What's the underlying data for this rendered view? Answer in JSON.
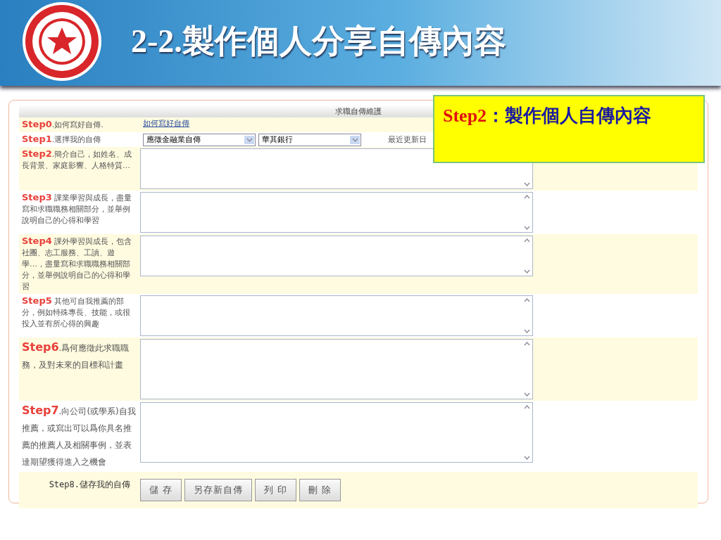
{
  "slide": {
    "title": "2-2.製作個人分享自傳內容"
  },
  "form": {
    "heading": "求職自傳維護",
    "steps": [
      {
        "kind": "link",
        "step": "Step0",
        "text": ".如何寫好自傳.",
        "link": "如何寫好自傳"
      },
      {
        "kind": "select",
        "step": "Step1",
        "text": ".選擇我的自傳",
        "selects": [
          "應徵金融業自傳",
          "華其銀行"
        ],
        "note": "最近更新日"
      },
      {
        "kind": "textarea",
        "step": "Step2",
        "text": ".簡介自己，如姓名、成長背景、家庭影響、人格特質…"
      },
      {
        "kind": "textarea",
        "step": "Step3",
        "text": " 課業學習與成長，盡量寫和求職職務相關部分，並舉例說明自己的心得和學習"
      },
      {
        "kind": "textarea",
        "step": "Step4",
        "text": " 課外學習與成長，包含社團、志工服務、工讀、遊學…，盡量寫和求職職務相關部分，並舉例說明自己的心得和學習"
      },
      {
        "kind": "textarea",
        "step": "Step5",
        "text": " 其他可自我推薦的部分，例如特殊專長、技能，或很投入並有所心得的興趣"
      },
      {
        "kind": "large",
        "step": "Step6",
        "text": ".爲何應徵此求職職務，及對未來的目標和計畫"
      },
      {
        "kind": "large",
        "step": "Step7",
        "text": ".向公司(或學系)自我推薦，或寫出可以爲你具名推薦的推薦人及相關事例，並表達期望獲得進入之機會"
      },
      {
        "kind": "buttons",
        "text": "Step8.儲存我的自傳",
        "buttons": [
          "儲 存",
          "另存新自傳",
          "列 印",
          "刪 除"
        ]
      }
    ]
  },
  "callout": {
    "step": "Step2",
    "text": "：製作個人自傳內容"
  }
}
